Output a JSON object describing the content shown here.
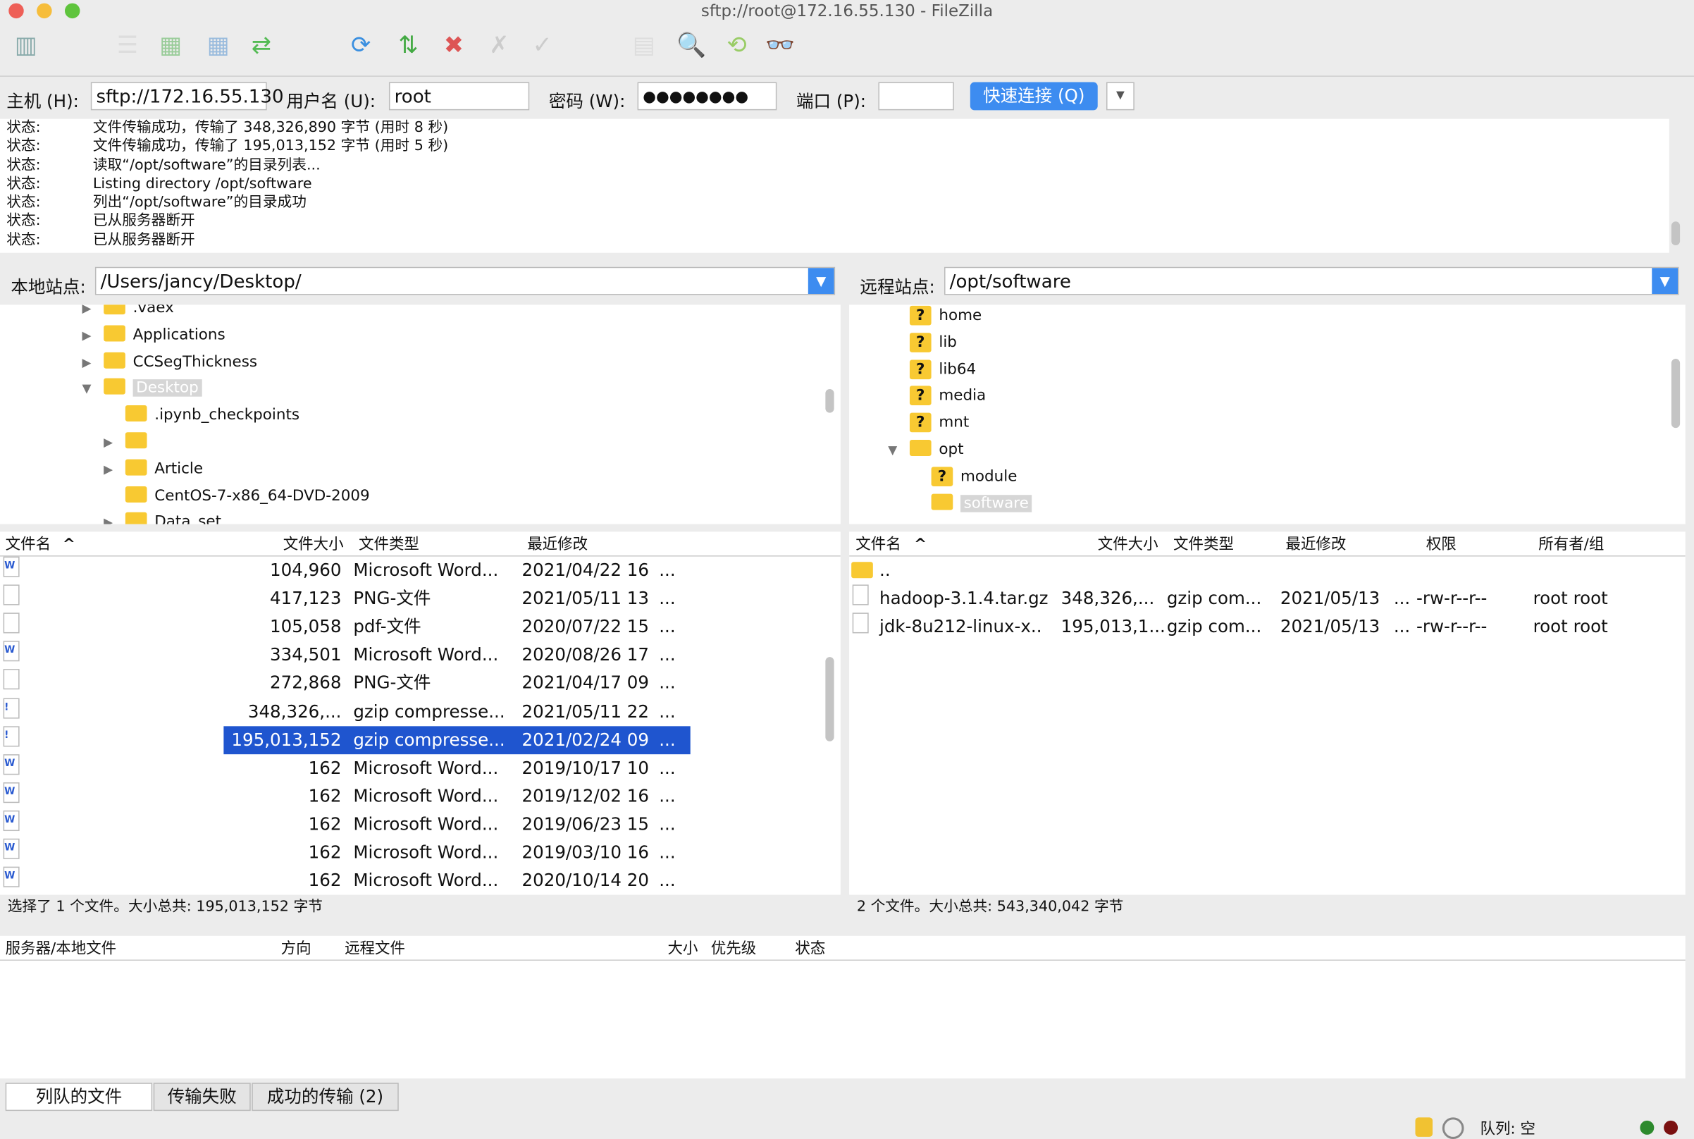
{
  "window": {
    "title": "sftp://root@172.16.55.130 - FileZilla"
  },
  "toolbar": {
    "icons": [
      "site-manager-icon",
      "message-log-icon",
      "local-tree-icon",
      "remote-tree-icon",
      "transfer-queue-icon",
      "refresh-icon",
      "process-queue-icon",
      "cancel-icon",
      "disconnect-icon",
      "reconnect-icon",
      "filter-icon",
      "compare-icon",
      "sync-browse-icon",
      "search-icon"
    ]
  },
  "quickconnect": {
    "host_label": "主机 (H):",
    "host": "sftp://172.16.55.130",
    "user_label": "用户名 (U):",
    "user": "root",
    "pass_label": "密码 (W):",
    "pass": "●●●●●●●●",
    "port_label": "端口 (P):",
    "port": "",
    "button": "快速连接 (Q)",
    "dropdown": "▼"
  },
  "log": [
    {
      "k": "状态:",
      "v": "文件传输成功，传输了 348,326,890 字节 (用时 8 秒)"
    },
    {
      "k": "状态:",
      "v": "文件传输成功，传输了 195,013,152 字节 (用时 5 秒)"
    },
    {
      "k": "状态:",
      "v": "读取“/opt/software”的目录列表..."
    },
    {
      "k": "状态:",
      "v": "Listing directory /opt/software"
    },
    {
      "k": "状态:",
      "v": "列出“/opt/software”的目录成功"
    },
    {
      "k": "状态:",
      "v": "已从服务器断开"
    },
    {
      "k": "状态:",
      "v": "已从服务器断开"
    }
  ],
  "local": {
    "site_label": "本地站点:",
    "path": "/Users/jancy/Desktop/",
    "tree": [
      {
        "label": ".vaex",
        "arrow": "▶",
        "level": 0
      },
      {
        "label": "Applications",
        "arrow": "▶",
        "level": 0
      },
      {
        "label": "CCSegThickness",
        "arrow": "▶",
        "level": 0
      },
      {
        "label": "Desktop",
        "arrow": "▼",
        "level": 0,
        "selected": true
      },
      {
        "label": ".ipynb_checkpoints",
        "arrow": "",
        "level": 1
      },
      {
        "label": "",
        "arrow": "▶",
        "level": 1
      },
      {
        "label": "Article",
        "arrow": "▶",
        "level": 1
      },
      {
        "label": "CentOS-7-x86_64-DVD-2009",
        "arrow": "",
        "level": 1
      },
      {
        "label": "Data_set",
        "arrow": "▶",
        "level": 1
      }
    ],
    "columns": [
      "文件名",
      "文件大小",
      "文件类型",
      "最近修改"
    ],
    "rows": [
      {
        "icon": "W",
        "size": "104,960",
        "type": "Microsoft Word...",
        "date": "2021/04/22 16",
        "more": "..."
      },
      {
        "icon": "",
        "size": "417,123",
        "type": "PNG-文件",
        "date": "2021/05/11 13",
        "more": "..."
      },
      {
        "icon": "",
        "size": "105,058",
        "type": "pdf-文件",
        "date": "2020/07/22 15",
        "more": "..."
      },
      {
        "icon": "W",
        "size": "334,501",
        "type": "Microsoft Word...",
        "date": "2020/08/26 17",
        "more": "..."
      },
      {
        "icon": "",
        "size": "272,868",
        "type": "PNG-文件",
        "date": "2021/04/17 09",
        "more": "..."
      },
      {
        "icon": "!",
        "size": "348,326,...",
        "type": "gzip compresse...",
        "date": "2021/05/11 22",
        "more": "..."
      },
      {
        "icon": "!",
        "size": "195,013,152",
        "type": "gzip compresse...",
        "date": "2021/02/24 09",
        "more": "...",
        "selected": true
      },
      {
        "icon": "W",
        "size": "162",
        "type": "Microsoft Word...",
        "date": "2019/10/17 10",
        "more": "..."
      },
      {
        "icon": "W",
        "size": "162",
        "type": "Microsoft Word...",
        "date": "2019/12/02 16",
        "more": "..."
      },
      {
        "icon": "W",
        "size": "162",
        "type": "Microsoft Word...",
        "date": "2019/06/23 15",
        "more": "..."
      },
      {
        "icon": "W",
        "size": "162",
        "type": "Microsoft Word...",
        "date": "2019/03/10 16",
        "more": "..."
      },
      {
        "icon": "W",
        "size": "162",
        "type": "Microsoft Word...",
        "date": "2020/10/14 20",
        "more": "..."
      }
    ],
    "status": "选择了 1 个文件。大小总共: 195,013,152 字节"
  },
  "remote": {
    "site_label": "远程站点:",
    "path": "/opt/software",
    "tree": [
      {
        "label": "home",
        "kind": "unknown",
        "level": 0
      },
      {
        "label": "lib",
        "kind": "unknown",
        "level": 0
      },
      {
        "label": "lib64",
        "kind": "unknown",
        "level": 0
      },
      {
        "label": "media",
        "kind": "unknown",
        "level": 0
      },
      {
        "label": "mnt",
        "kind": "unknown",
        "level": 0
      },
      {
        "label": "opt",
        "kind": "folder",
        "level": 0,
        "arrow": "▼"
      },
      {
        "label": "module",
        "kind": "unknown",
        "level": 1
      },
      {
        "label": "software",
        "kind": "folder",
        "level": 1,
        "selected": true
      }
    ],
    "columns": [
      "文件名",
      "文件大小",
      "文件类型",
      "最近修改",
      "权限",
      "所有者/组"
    ],
    "rows": [
      {
        "name": "..",
        "size": "",
        "type": "",
        "date": "",
        "more": "",
        "perm": "",
        "owner": "",
        "folder": true
      },
      {
        "name": "hadoop-3.1.4.tar.gz",
        "size": "348,326,...",
        "type": "gzip com...",
        "date": "2021/05/13",
        "more": "...",
        "perm": "-rw-r--r--",
        "owner": "root root"
      },
      {
        "name": "jdk-8u212-linux-x..",
        "size": "195,013,1...",
        "type": "gzip com...",
        "date": "2021/05/13",
        "more": "...",
        "perm": "-rw-r--r--",
        "owner": "root root"
      }
    ],
    "status": "2 个文件。大小总共: 543,340,042 字节"
  },
  "queue": {
    "columns": [
      "服务器/本地文件",
      "方向",
      "远程文件",
      "大小",
      "优先级",
      "状态"
    ]
  },
  "tabs": [
    "列队的文件",
    "传输失败",
    "成功的传输 (2)"
  ],
  "statusbar": {
    "queue": "队列: 空"
  },
  "colors": {
    "accent": "#3d8cf0",
    "selection": "#1f55cf",
    "folder": "#f8c932"
  }
}
